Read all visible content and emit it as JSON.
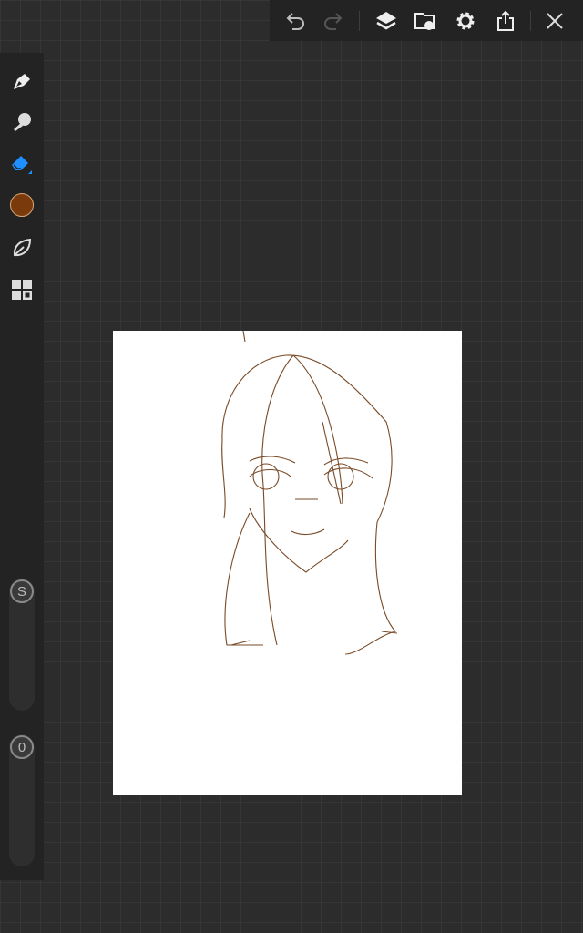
{
  "toolbar": {
    "icons": [
      "undo-icon",
      "redo-icon",
      "layers-icon",
      "gallery-icon",
      "settings-icon",
      "share-icon",
      "close-icon"
    ]
  },
  "sidebar": {
    "tools": [
      "brush-tool",
      "smudge-tool",
      "eraser-tool",
      "color-picker",
      "leaf-tool",
      "grid-tool"
    ],
    "active_tool": "eraser-tool",
    "active_color": "#7a3a0c",
    "accent": "#1e90ff"
  },
  "sliders": {
    "size_label": "S",
    "opacity_label": "0"
  },
  "colors": {
    "stroke": "#7a4a26"
  }
}
